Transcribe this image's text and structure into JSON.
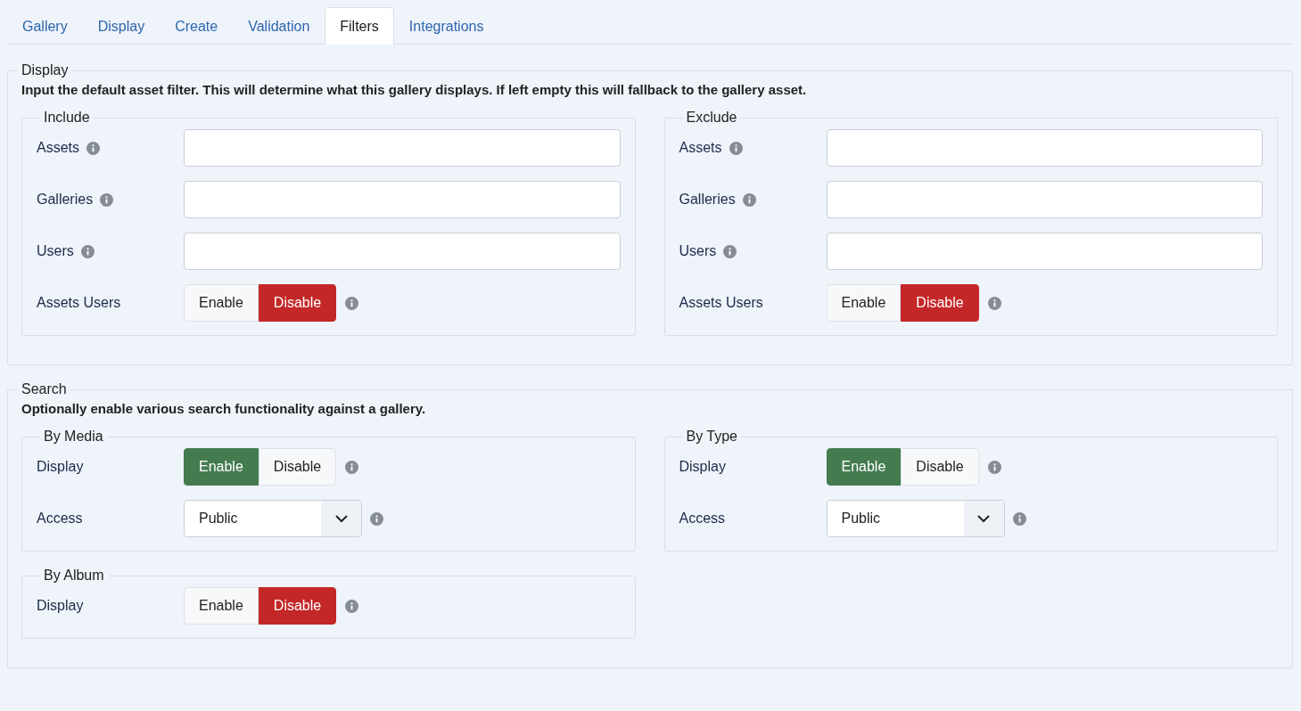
{
  "tabs": [
    {
      "label": "Gallery",
      "selected": false
    },
    {
      "label": "Display",
      "selected": false
    },
    {
      "label": "Create",
      "selected": false
    },
    {
      "label": "Validation",
      "selected": false
    },
    {
      "label": "Filters",
      "selected": true
    },
    {
      "label": "Integrations",
      "selected": false
    }
  ],
  "sections": [
    {
      "legend": "Display",
      "description": "Input the default asset filter. This will determine what this gallery displays. If left empty this will fallback to the gallery asset.",
      "groups": [
        {
          "legend": "Include",
          "fields": [
            {
              "kind": "text",
              "label": "Assets"
            },
            {
              "kind": "text",
              "label": "Galleries"
            },
            {
              "kind": "text",
              "label": "Users"
            },
            {
              "kind": "toggle",
              "label": "Assets Users",
              "options": [
                {
                  "label": "Enable",
                  "selected": false
                },
                {
                  "label": "Disable",
                  "selected": true
                }
              ]
            }
          ]
        },
        {
          "legend": "Exclude",
          "fields": [
            {
              "kind": "text",
              "label": "Assets"
            },
            {
              "kind": "text",
              "label": "Galleries"
            },
            {
              "kind": "text",
              "label": "Users"
            },
            {
              "kind": "toggle",
              "label": "Assets Users",
              "options": [
                {
                  "label": "Enable",
                  "selected": false
                },
                {
                  "label": "Disable",
                  "selected": true
                }
              ]
            }
          ]
        }
      ]
    },
    {
      "legend": "Search",
      "description": "Optionally enable various search functionality against a gallery.",
      "groups": [
        {
          "legend": "By Media",
          "fields": [
            {
              "kind": "toggle",
              "label": "Display",
              "options": [
                {
                  "label": "Enable",
                  "selected": true
                },
                {
                  "label": "Disable",
                  "selected": false
                }
              ]
            },
            {
              "kind": "select",
              "label": "Access",
              "value": "Public"
            }
          ]
        },
        {
          "legend": "By Type",
          "fields": [
            {
              "kind": "toggle",
              "label": "Display",
              "options": [
                {
                  "label": "Enable",
                  "selected": true
                },
                {
                  "label": "Disable",
                  "selected": false
                }
              ]
            },
            {
              "kind": "select",
              "label": "Access",
              "value": "Public"
            }
          ]
        },
        {
          "legend": "By Album",
          "fields": [
            {
              "kind": "toggle",
              "label": "Display",
              "options": [
                {
                  "label": "Enable",
                  "selected": false
                },
                {
                  "label": "Disable",
                  "selected": true
                }
              ]
            }
          ]
        }
      ]
    }
  ]
}
